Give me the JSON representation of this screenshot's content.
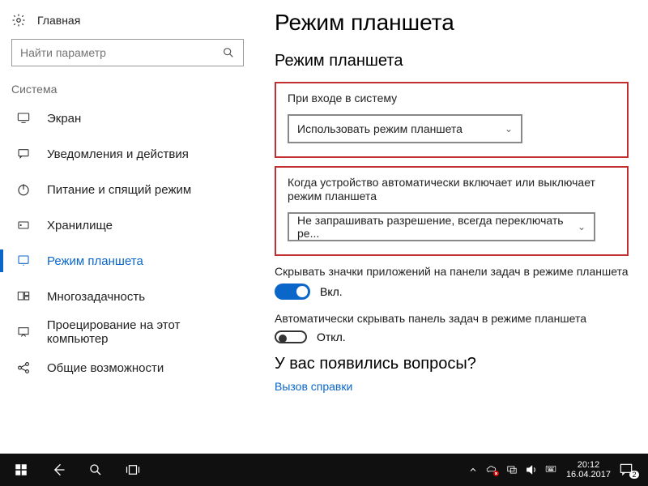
{
  "home_label": "Главная",
  "search": {
    "placeholder": "Найти параметр"
  },
  "category_title": "Система",
  "sidebar": {
    "items": [
      {
        "label": "Экран"
      },
      {
        "label": "Уведомления и действия"
      },
      {
        "label": "Питание и спящий режим"
      },
      {
        "label": "Хранилище"
      },
      {
        "label": "Режим планшета"
      },
      {
        "label": "Многозадачность"
      },
      {
        "label": "Проецирование на этот компьютер"
      },
      {
        "label": "Общие возможности"
      }
    ]
  },
  "page": {
    "title": "Режим планшета",
    "subtitle": "Режим планшета",
    "group1_label": "При входе в систему",
    "group1_value": "Использовать режим планшета",
    "group2_label": "Когда устройство автоматически включает или выключает режим планшета",
    "group2_value": "Не запрашивать разрешение, всегда переключать ре...",
    "opt1_label": "Скрывать значки приложений на панели задач в режиме планшета",
    "opt1_state": "Вкл.",
    "opt2_label": "Автоматически скрывать панель задач в режиме планшета",
    "opt2_state": "Откл.",
    "help_title": "У вас появились вопросы?",
    "help_link": "Вызов справки"
  },
  "taskbar": {
    "time": "20:12",
    "date": "16.04.2017",
    "notif_count": "2"
  }
}
